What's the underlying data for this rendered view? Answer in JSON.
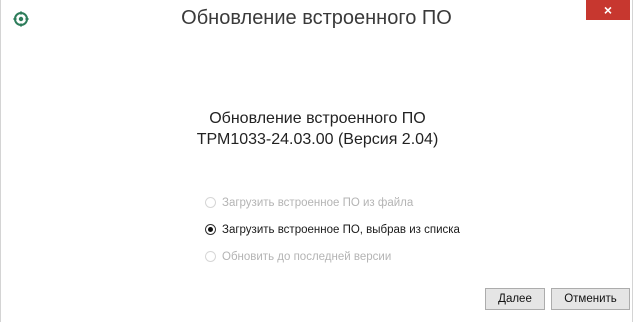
{
  "window": {
    "title": "Обновление встроенного ПО",
    "app_icon": "gear-icon",
    "close_label": "×",
    "accent_close": "#c7372f"
  },
  "heading": {
    "line1": "Обновление встроенного ПО",
    "line2": "ТРМ1033-24.03.00 (Версия 2.04)"
  },
  "options": [
    {
      "label": "Загрузить встроенное ПО из файла",
      "enabled": false,
      "checked": false
    },
    {
      "label": "Загрузить встроенное ПО, выбрав из списка",
      "enabled": true,
      "checked": true
    },
    {
      "label": "Обновить до последней версии",
      "enabled": false,
      "checked": false
    }
  ],
  "buttons": {
    "next_label": "Далее",
    "cancel_label": "Отменить"
  }
}
